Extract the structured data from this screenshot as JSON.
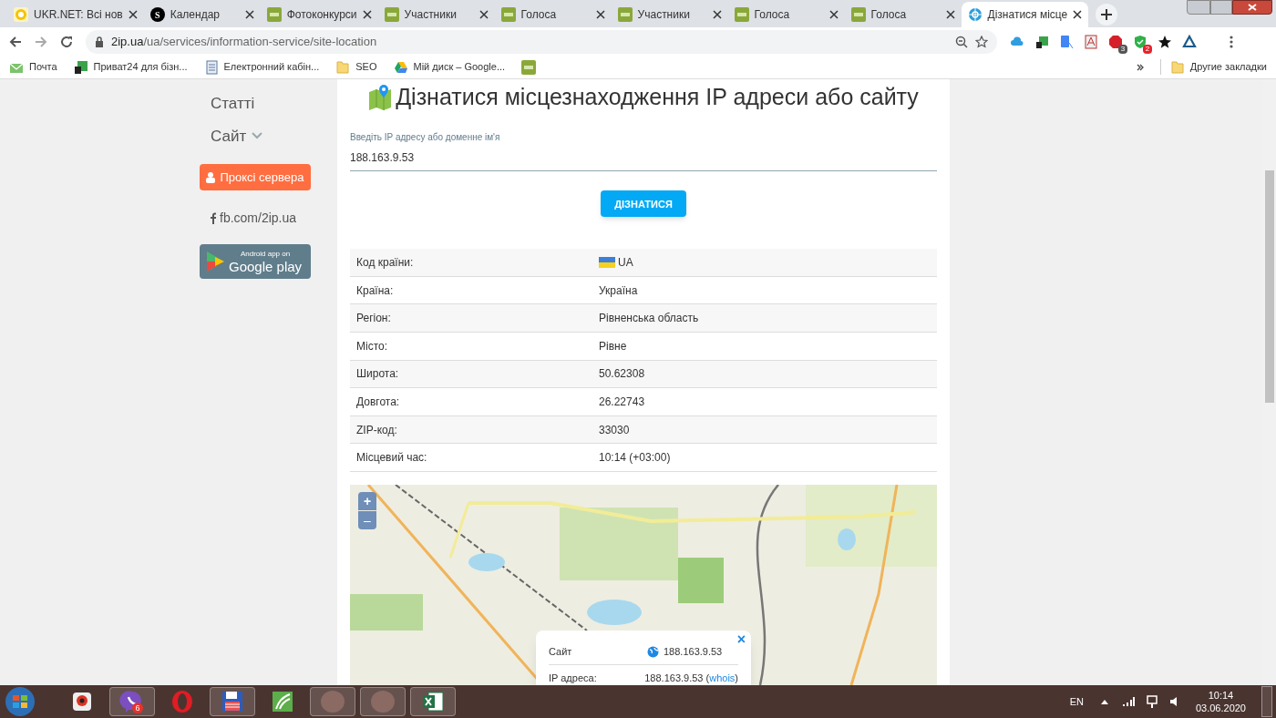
{
  "tabs": [
    {
      "title": "UKR.NET: Всі нов",
      "kind": "ukrnet",
      "selected": false
    },
    {
      "title": "Календар",
      "kind": "letter",
      "icon_text": "S",
      "selected": false
    },
    {
      "title": "Фотоконкурси",
      "kind": "tag",
      "selected": false
    },
    {
      "title": "Участники",
      "kind": "tag",
      "selected": false
    },
    {
      "title": "Голоса",
      "kind": "tag",
      "selected": false
    },
    {
      "title": "Участники",
      "kind": "tag",
      "selected": false
    },
    {
      "title": "Голоса",
      "kind": "tag",
      "selected": false
    },
    {
      "title": "Голоса",
      "kind": "tag",
      "selected": false
    },
    {
      "title": "Дізнатися місце",
      "kind": "globe",
      "selected": true
    }
  ],
  "address_bar": {
    "host": "2ip.ua",
    "path": "/ua/services/information-service/site-location"
  },
  "extensions": [
    {
      "kind": "cloud"
    },
    {
      "kind": "privat"
    },
    {
      "kind": "translate"
    },
    {
      "kind": "pdf"
    },
    {
      "kind": "adblock",
      "badge": "3"
    },
    {
      "kind": "shield",
      "badge": "2"
    },
    {
      "kind": "star"
    },
    {
      "kind": "delta"
    }
  ],
  "bookmarks": [
    {
      "label": "Почта",
      "kind": "mail"
    },
    {
      "label": "Приват24 для бізн...",
      "kind": "privat"
    },
    {
      "label": "Електронний кабін...",
      "kind": "doc"
    },
    {
      "label": "SEO",
      "kind": "folder"
    },
    {
      "label": "Мій диск – Google...",
      "kind": "drive"
    },
    {
      "kind": "tag"
    }
  ],
  "other_bookmarks": "Другие закладки",
  "sidebar": {
    "links": [
      {
        "label": "Статті",
        "dropdown": false
      },
      {
        "label": "Сайт",
        "dropdown": true
      }
    ],
    "proxy_button": "Проксі сервера",
    "facebook": "fb.com/2ip.ua",
    "store_badge": {
      "line1": "Android app on",
      "line2": "Google play"
    }
  },
  "page_title": "Дізнатися місцезнаходження IP адреси або сайту",
  "ip_field": {
    "label": "Введіть IP адресу або доменне ім'я",
    "value": "188.163.9.53"
  },
  "submit_button": "ДІЗНАТИСЯ",
  "results": [
    {
      "label": "Код країни:",
      "value": "UA",
      "flag": true
    },
    {
      "label": "Країна:",
      "value": "Україна",
      "flag": false
    },
    {
      "label": "Регіон:",
      "value": "Рівненська область",
      "flag": false
    },
    {
      "label": "Місто:",
      "value": "Рівне",
      "flag": false
    },
    {
      "label": "Широта:",
      "value": "50.62308",
      "flag": false
    },
    {
      "label": "Довгота:",
      "value": "26.22743",
      "flag": false
    },
    {
      "label": "ZIP-код:",
      "value": "33030",
      "flag": false
    },
    {
      "label": "Місцевий час:",
      "value": "10:14 (+03:00)",
      "flag": false
    }
  ],
  "map": {
    "zoom_in": "+",
    "zoom_out": "–",
    "popup": {
      "close": "×",
      "rows": [
        {
          "label": "Сайт",
          "value": "188.163.9.53",
          "globe": true
        },
        {
          "label": "IP адреса:",
          "value": "188.163.9.53 (",
          "link": "whois",
          "after_link": ")",
          "globe": false
        }
      ]
    }
  },
  "taskbar": {
    "apps": [
      {
        "kind": "camera",
        "open": false
      },
      {
        "kind": "viber",
        "open": true,
        "badge": "6"
      },
      {
        "kind": "opera",
        "open": false
      },
      {
        "kind": "floppy",
        "open": true
      },
      {
        "kind": "corel",
        "open": false
      },
      {
        "kind": "blank",
        "open": true
      },
      {
        "kind": "blank",
        "open": true
      },
      {
        "kind": "excel",
        "open": true
      }
    ],
    "language": "EN",
    "time": "10:14",
    "date": "03.06.2020"
  }
}
